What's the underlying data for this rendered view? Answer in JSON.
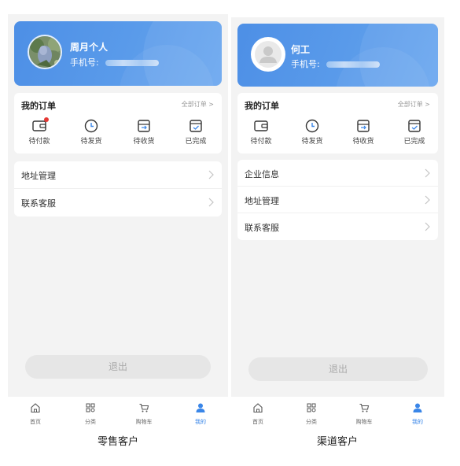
{
  "screens": [
    {
      "user_name": "周月个人",
      "phone_label": "手机号:",
      "orders_title": "我的订单",
      "all_orders": "全部订单 >",
      "order_items": [
        "待付款",
        "待发货",
        "待收货",
        "已完成"
      ],
      "menu_items": [
        "地址管理",
        "联系客服"
      ],
      "logout": "退出",
      "tabs": [
        "首页",
        "分类",
        "购物车",
        "我的"
      ],
      "caption": "零售客户"
    },
    {
      "user_name": "何工",
      "phone_label": "手机号:",
      "orders_title": "我的订单",
      "all_orders": "全部订单 >",
      "order_items": [
        "待付款",
        "待发货",
        "待收货",
        "已完成"
      ],
      "menu_items": [
        "企业信息",
        "地址管理",
        "联系客服"
      ],
      "logout": "退出",
      "tabs": [
        "首页",
        "分类",
        "购物车",
        "我的"
      ],
      "caption": "渠道客户"
    }
  ],
  "colors": {
    "accent": "#3a86e8",
    "badge": "#e53935",
    "header_gradient": "#4d8fe6"
  },
  "icons": {
    "orders": [
      "wallet-icon",
      "clock-icon",
      "inbox-icon",
      "check-box-icon"
    ],
    "tabs": [
      "home-icon",
      "grid-icon",
      "cart-icon",
      "user-icon"
    ],
    "active_tab_index": 3
  }
}
